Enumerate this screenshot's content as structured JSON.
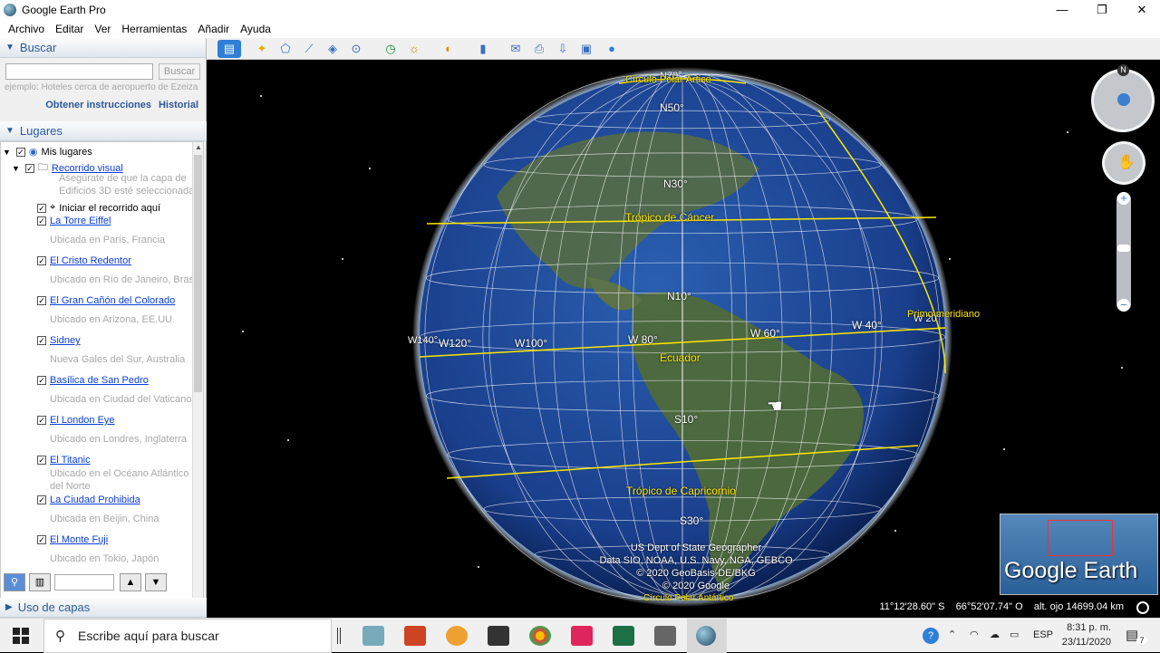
{
  "window": {
    "title": "Google Earth Pro",
    "minimize": "—",
    "maximize": "❐",
    "close": "✕"
  },
  "menu": [
    "Archivo",
    "Editar",
    "Ver",
    "Herramientas",
    "Añadir",
    "Ayuda"
  ],
  "search": {
    "header": "Buscar",
    "placeholder": "",
    "button": "Buscar",
    "hint": "ejemplo: Hoteles cerca de aeropuerto de Ezeiza",
    "link_directions": "Obtener instrucciones",
    "link_history": "Historial"
  },
  "places": {
    "header": "Lugares",
    "root": "Mis lugares",
    "tour": "Recorrido visual",
    "tour_note_1": "Asegúrate de que la capa de",
    "tour_note_2": "Edificios 3D esté seleccionada",
    "tour_start": "Iniciar el recorrido aquí",
    "items": [
      {
        "name": "La Torre Eiffel",
        "desc": "Ubicada en París, Francia"
      },
      {
        "name": "El Cristo Redentor",
        "desc": "Ubicado en Río de Janeiro, Brasi"
      },
      {
        "name": "El Gran Cañón del Colorado",
        "desc": "Ubicado en Arizona, EE.UU."
      },
      {
        "name": "Sidney",
        "desc": "Nueva Gales del Sur, Australia"
      },
      {
        "name": "Basílica de San Pedro",
        "desc": "Ubicada en Ciudad del Vaticano"
      },
      {
        "name": "El London Eye",
        "desc": "Ubicado en Londres, Inglaterra"
      },
      {
        "name": "El Titanic",
        "desc": "Ubicado en el Océano Atlántico",
        "desc2": "del Norte"
      },
      {
        "name": "La Ciudad Prohibida",
        "desc": "Ubicada en Beijin, China"
      },
      {
        "name": "El Monte Fuji",
        "desc": "Ubicado en Tokio, Japón"
      }
    ]
  },
  "layers": {
    "header": "Uso de capas"
  },
  "globe": {
    "labels": {
      "n70": "N70°",
      "arctic": "Círculo Polar Ártico",
      "n50": "N50°",
      "n30": "N30°",
      "cancer": "Trópico de Cáncer",
      "n10": "N10°",
      "w140": "W140°",
      "w120": "W120°",
      "w100": "W100°",
      "w80": "W 80°",
      "w60": "W 60°",
      "w40": "W 40°",
      "w20": "W 20°",
      "meridian": "Primo meridiano",
      "equator": "Ecuador",
      "s10": "S10°",
      "capricorn": "Trópico de Capricornio",
      "s30": "S30°",
      "antarctic": "Círculo Polar Antártico"
    },
    "credits": [
      "US Dept of State Geographer",
      "Data SIO, NOAA, U.S. Navy, NGA, GEBCO",
      "© 2020 GeoBasis-DE/BKG",
      "© 2020 Google"
    ],
    "status": {
      "lat": "11°12'28.60\" S",
      "lon": "66°52'07.74\" O",
      "alt": "alt. ojo 14699.04 km"
    },
    "logo": "Google Earth",
    "compass_n": "N",
    "colors": {
      "grid": "#ffffff",
      "lines": "#ffe800",
      "ocean": "#1a3f8c"
    }
  },
  "taskbar": {
    "search_placeholder": "Escribe aquí para buscar",
    "lang": "ESP",
    "time": "8:31 p. m.",
    "date": "23/11/2020",
    "notifications": "7"
  }
}
